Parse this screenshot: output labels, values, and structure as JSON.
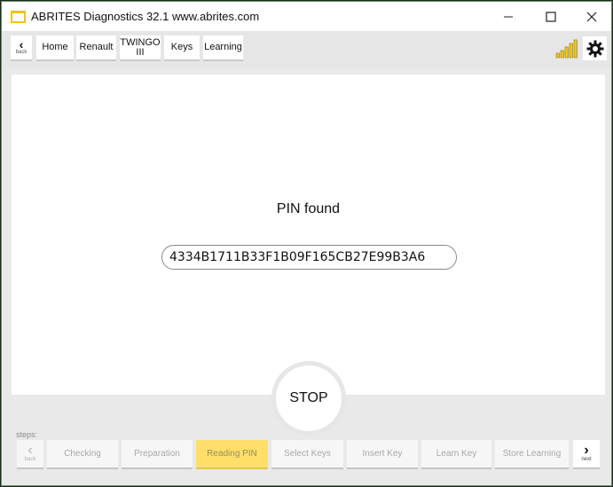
{
  "window": {
    "title": "ABRITES Diagnostics 32.1    www.abrites.com"
  },
  "nav": {
    "back_label": "back",
    "items": [
      "Home",
      "Renault",
      "TWINGO",
      "III",
      "Keys",
      "Learning"
    ]
  },
  "main": {
    "heading": "PIN found",
    "pin_value": "4334B1711B33F1B09F165CB27E99B3A6"
  },
  "stop": {
    "label": "STOP"
  },
  "steps": {
    "label": "steps:",
    "back_label": "back",
    "next_label": "next",
    "items": [
      "Checking",
      "Preparation",
      "Reading PIN",
      "Select Keys",
      "Insert Key",
      "Learn Key",
      "Store Learning"
    ],
    "active_index": 2
  },
  "colors": {
    "accent": "#ffdf6a",
    "icon_yellow": "#f0c419"
  }
}
